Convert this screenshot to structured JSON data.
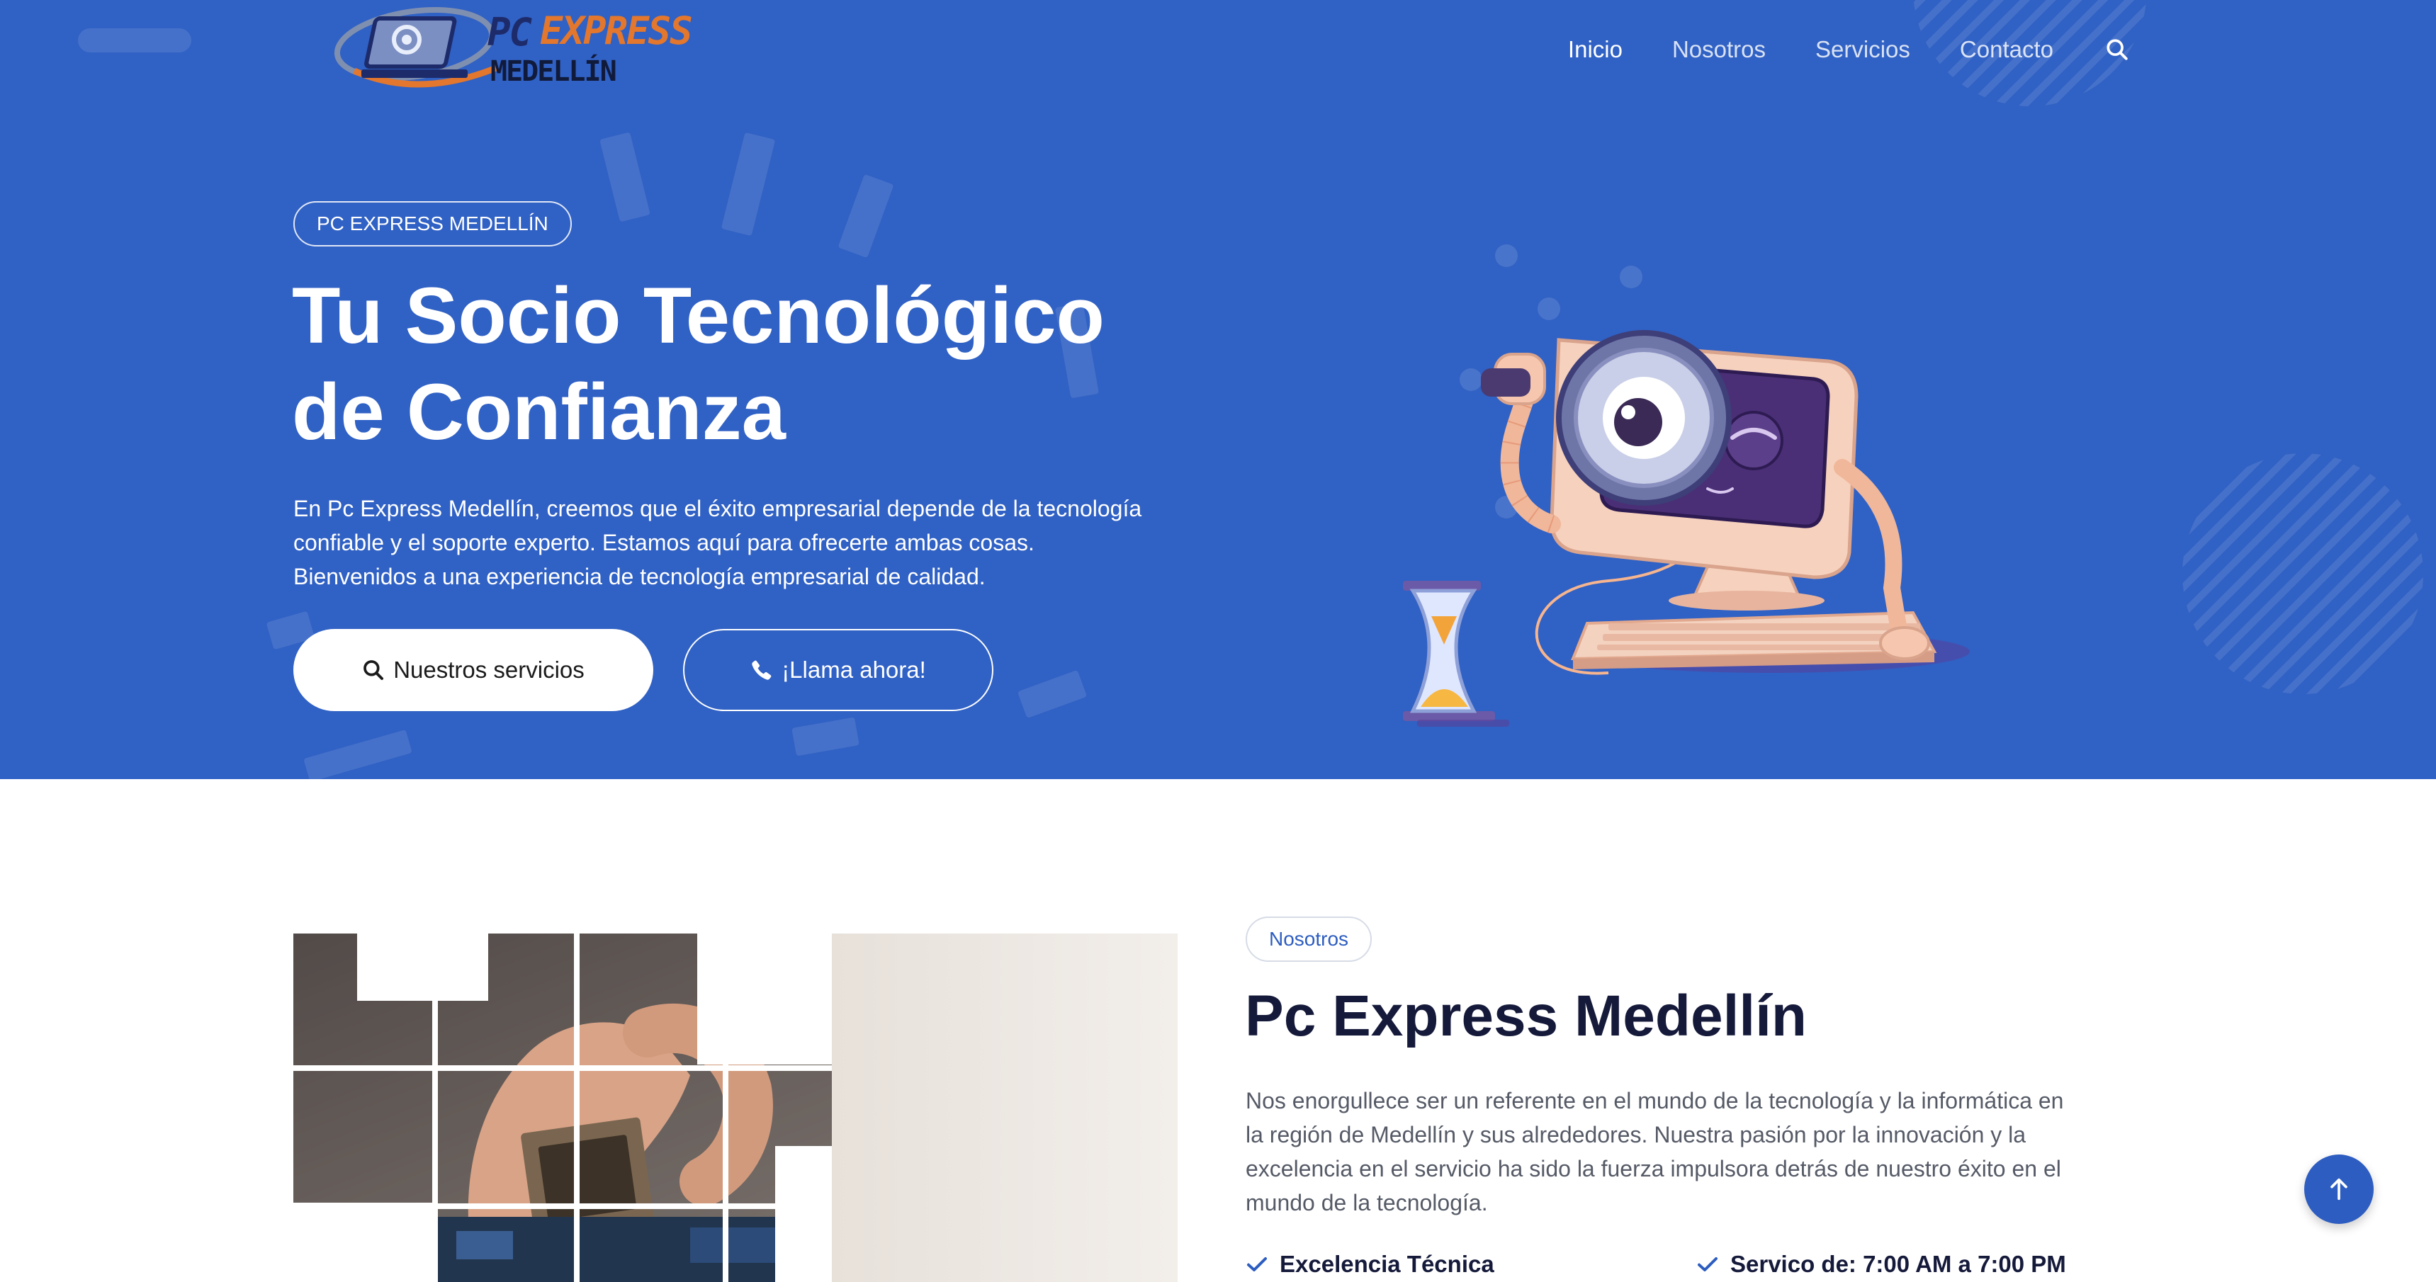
{
  "brand": {
    "logo_pc": "PC",
    "logo_express": "EXPRESS",
    "logo_medellin": "MEDELLÍN"
  },
  "nav": {
    "items": [
      {
        "label": "Inicio",
        "active": true
      },
      {
        "label": "Nosotros",
        "active": false
      },
      {
        "label": "Servicios",
        "active": false
      },
      {
        "label": "Contacto",
        "active": false
      }
    ],
    "search_icon": "search-icon"
  },
  "hero": {
    "badge": "PC EXPRESS MEDELLÍN",
    "title_line1": "Tu Socio Tecnológico",
    "title_line2": "de Confianza",
    "text_line1": "En Pc Express Medellín, creemos que el éxito empresarial depende de la tecnología",
    "text_line2": "confiable y el soporte experto. Estamos aquí para ofrecerte ambas cosas.",
    "text_line3": "Bienvenidos a una experiencia de tecnología empresarial de calidad.",
    "btn_services": "Nuestros servicios",
    "btn_call": "¡Llama ahora!"
  },
  "about": {
    "badge": "Nosotros",
    "title": "Pc Express Medellín",
    "text_line1": "Nos enorgullece ser un referente en el mundo de la tecnología y la informática en",
    "text_line2": "la región de Medellín y sus alrededores. Nuestra pasión por la innovación y la",
    "text_line3": "excelencia en el servicio ha sido la fuerza impulsora detrás de nuestro éxito en el",
    "text_line4": "mundo de la tecnología.",
    "features": [
      "Excelencia Técnica",
      "Servico de: 7:00 AM a 7:00 PM"
    ]
  },
  "colors": {
    "hero_bg": "#3061c4",
    "accent": "#2d5dc0",
    "logo_orange": "#e2772d",
    "title_dark": "#151a3a"
  }
}
